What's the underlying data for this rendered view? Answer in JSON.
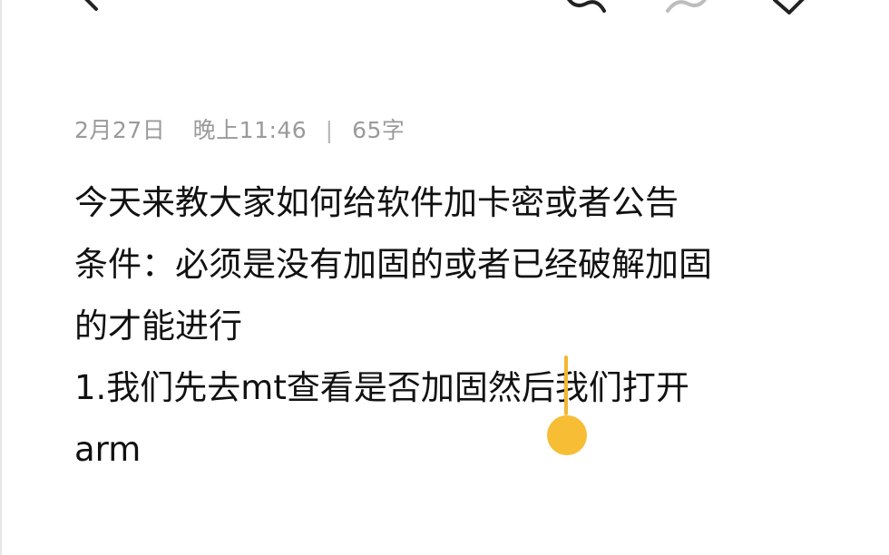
{
  "toolbar": {
    "back_icon": "chevron-left-icon",
    "undo_icon": "undo-icon",
    "redo_icon": "redo-icon",
    "confirm_icon": "check-icon"
  },
  "note": {
    "date": "2月27日",
    "time": "晚上11:46",
    "separator": "|",
    "char_count": "65字",
    "lines": [
      "今天来教大家如何给软件加卡密或者公告",
      "条件：必须是没有加固的或者已经破解加固",
      "的才能进行",
      "1.我们先去mt查看是否加固然后我们打开",
      "arm"
    ]
  },
  "colors": {
    "accent": "#f2b830",
    "meta_text": "#9a9a9a",
    "body_text": "#111111"
  }
}
